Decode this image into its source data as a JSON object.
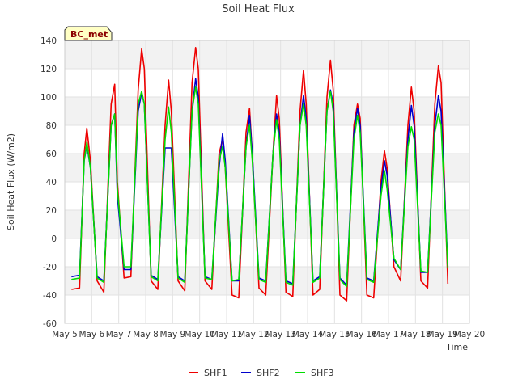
{
  "chart_data": {
    "type": "line",
    "title": "Soil Heat Flux",
    "xlabel": "Time",
    "ylabel": "Soil Heat Flux (W/m2)",
    "site_label": "BC_met",
    "xlim": [
      5,
      20
    ],
    "ylim": [
      -60,
      140
    ],
    "x_ticks": [
      5,
      6,
      7,
      8,
      9,
      10,
      11,
      12,
      13,
      14,
      15,
      16,
      17,
      18,
      19,
      20
    ],
    "x_tick_labels": [
      "May 5",
      "May 6",
      "May 7",
      "May 8",
      "May 9",
      "May 10",
      "May 11",
      "May 12",
      "May 13",
      "May 14",
      "May 15",
      "May 16",
      "May 17",
      "May 18",
      "May 19",
      "May 20"
    ],
    "y_ticks": [
      -60,
      -40,
      -20,
      0,
      20,
      40,
      60,
      80,
      100,
      120,
      140
    ],
    "y_tick_labels": [
      "-60",
      "-40",
      "-20",
      "0",
      "20",
      "40",
      "60",
      "80",
      "100",
      "120",
      "140"
    ],
    "grid": true,
    "legend_position": "bottom-center",
    "series": [
      {
        "name": "SHF1",
        "color": "#ee0000",
        "x": [
          5.25,
          5.55,
          5.72,
          5.82,
          5.95,
          6.2,
          6.45,
          6.72,
          6.85,
          6.95,
          7.2,
          7.45,
          7.72,
          7.85,
          7.95,
          8.2,
          8.45,
          8.72,
          8.85,
          8.95,
          9.2,
          9.45,
          9.72,
          9.85,
          9.95,
          10.2,
          10.45,
          10.72,
          10.85,
          10.95,
          11.2,
          11.45,
          11.72,
          11.85,
          11.95,
          12.2,
          12.45,
          12.72,
          12.85,
          12.95,
          13.2,
          13.45,
          13.72,
          13.85,
          13.95,
          14.2,
          14.45,
          14.72,
          14.85,
          14.95,
          15.2,
          15.45,
          15.72,
          15.85,
          15.95,
          16.2,
          16.45,
          16.72,
          16.85,
          16.95,
          17.2,
          17.45,
          17.72,
          17.85,
          17.95,
          18.2,
          18.45,
          18.72,
          18.85,
          18.95,
          19.2
        ],
        "y": [
          -36,
          -35,
          60,
          78,
          55,
          -30,
          -38,
          95,
          109,
          40,
          -28,
          -27,
          105,
          134,
          120,
          -30,
          -36,
          80,
          112,
          90,
          -30,
          -37,
          110,
          135,
          120,
          -30,
          -36,
          60,
          70,
          50,
          -40,
          -42,
          75,
          92,
          60,
          -35,
          -40,
          60,
          101,
          85,
          -38,
          -41,
          90,
          119,
          95,
          -40,
          -36,
          100,
          126,
          105,
          -40,
          -44,
          80,
          95,
          85,
          -40,
          -42,
          40,
          62,
          50,
          -20,
          -30,
          80,
          107,
          90,
          -30,
          -35,
          95,
          122,
          110,
          -32
        ]
      },
      {
        "name": "SHF2",
        "color": "#0000cc",
        "x": [
          5.25,
          5.55,
          5.72,
          5.82,
          5.95,
          6.2,
          6.45,
          6.72,
          6.85,
          6.95,
          7.2,
          7.45,
          7.72,
          7.85,
          7.95,
          8.2,
          8.45,
          8.72,
          8.85,
          8.95,
          9.2,
          9.45,
          9.72,
          9.85,
          9.95,
          10.2,
          10.45,
          10.72,
          10.85,
          10.95,
          11.2,
          11.45,
          11.72,
          11.85,
          11.95,
          12.2,
          12.45,
          12.72,
          12.85,
          12.95,
          13.2,
          13.45,
          13.72,
          13.85,
          13.95,
          14.2,
          14.45,
          14.72,
          14.85,
          14.95,
          15.2,
          15.45,
          15.72,
          15.85,
          15.95,
          16.2,
          16.45,
          16.72,
          16.85,
          16.95,
          17.2,
          17.45,
          17.72,
          17.85,
          17.95,
          18.2,
          18.45,
          18.72,
          18.85,
          18.95,
          19.2
        ],
        "y": [
          -27,
          -26,
          55,
          66,
          50,
          -27,
          -30,
          80,
          88,
          30,
          -22,
          -22,
          90,
          103,
          95,
          -26,
          -29,
          64,
          64,
          64,
          -27,
          -30,
          90,
          113,
          100,
          -27,
          -29,
          50,
          74,
          55,
          -30,
          -30,
          65,
          87,
          60,
          -28,
          -30,
          60,
          88,
          75,
          -30,
          -32,
          80,
          101,
          85,
          -30,
          -27,
          90,
          105,
          95,
          -28,
          -33,
          75,
          92,
          80,
          -28,
          -30,
          35,
          55,
          45,
          -15,
          -22,
          70,
          94,
          80,
          -24,
          -24,
          80,
          101,
          90,
          -20
        ]
      },
      {
        "name": "SHF3",
        "color": "#00dd00",
        "x": [
          5.25,
          5.55,
          5.72,
          5.82,
          5.95,
          6.2,
          6.45,
          6.72,
          6.85,
          6.95,
          7.2,
          7.45,
          7.72,
          7.85,
          7.95,
          8.2,
          8.45,
          8.72,
          8.85,
          8.95,
          9.2,
          9.45,
          9.72,
          9.85,
          9.95,
          10.2,
          10.45,
          10.72,
          10.85,
          10.95,
          11.2,
          11.45,
          11.72,
          11.85,
          11.95,
          12.2,
          12.45,
          12.72,
          12.85,
          12.95,
          13.2,
          13.45,
          13.72,
          13.85,
          13.95,
          14.2,
          14.45,
          14.72,
          14.85,
          14.95,
          15.2,
          15.45,
          15.72,
          15.85,
          15.95,
          16.2,
          16.45,
          16.72,
          16.85,
          16.95,
          17.2,
          17.45,
          17.72,
          17.85,
          17.95,
          18.2,
          18.45,
          18.72,
          18.85,
          18.95,
          19.2
        ],
        "y": [
          -29,
          -28,
          55,
          68,
          50,
          -28,
          -31,
          80,
          88,
          35,
          -20,
          -20,
          95,
          104,
          95,
          -27,
          -30,
          70,
          93,
          75,
          -28,
          -31,
          90,
          107,
          95,
          -28,
          -29,
          55,
          65,
          50,
          -30,
          -29,
          65,
          80,
          55,
          -29,
          -31,
          60,
          84,
          70,
          -31,
          -33,
          80,
          95,
          80,
          -31,
          -28,
          90,
          104,
          90,
          -29,
          -34,
          70,
          87,
          75,
          -29,
          -31,
          30,
          48,
          35,
          -14,
          -22,
          65,
          79,
          70,
          -23,
          -24,
          75,
          88,
          80,
          -21
        ]
      }
    ]
  }
}
